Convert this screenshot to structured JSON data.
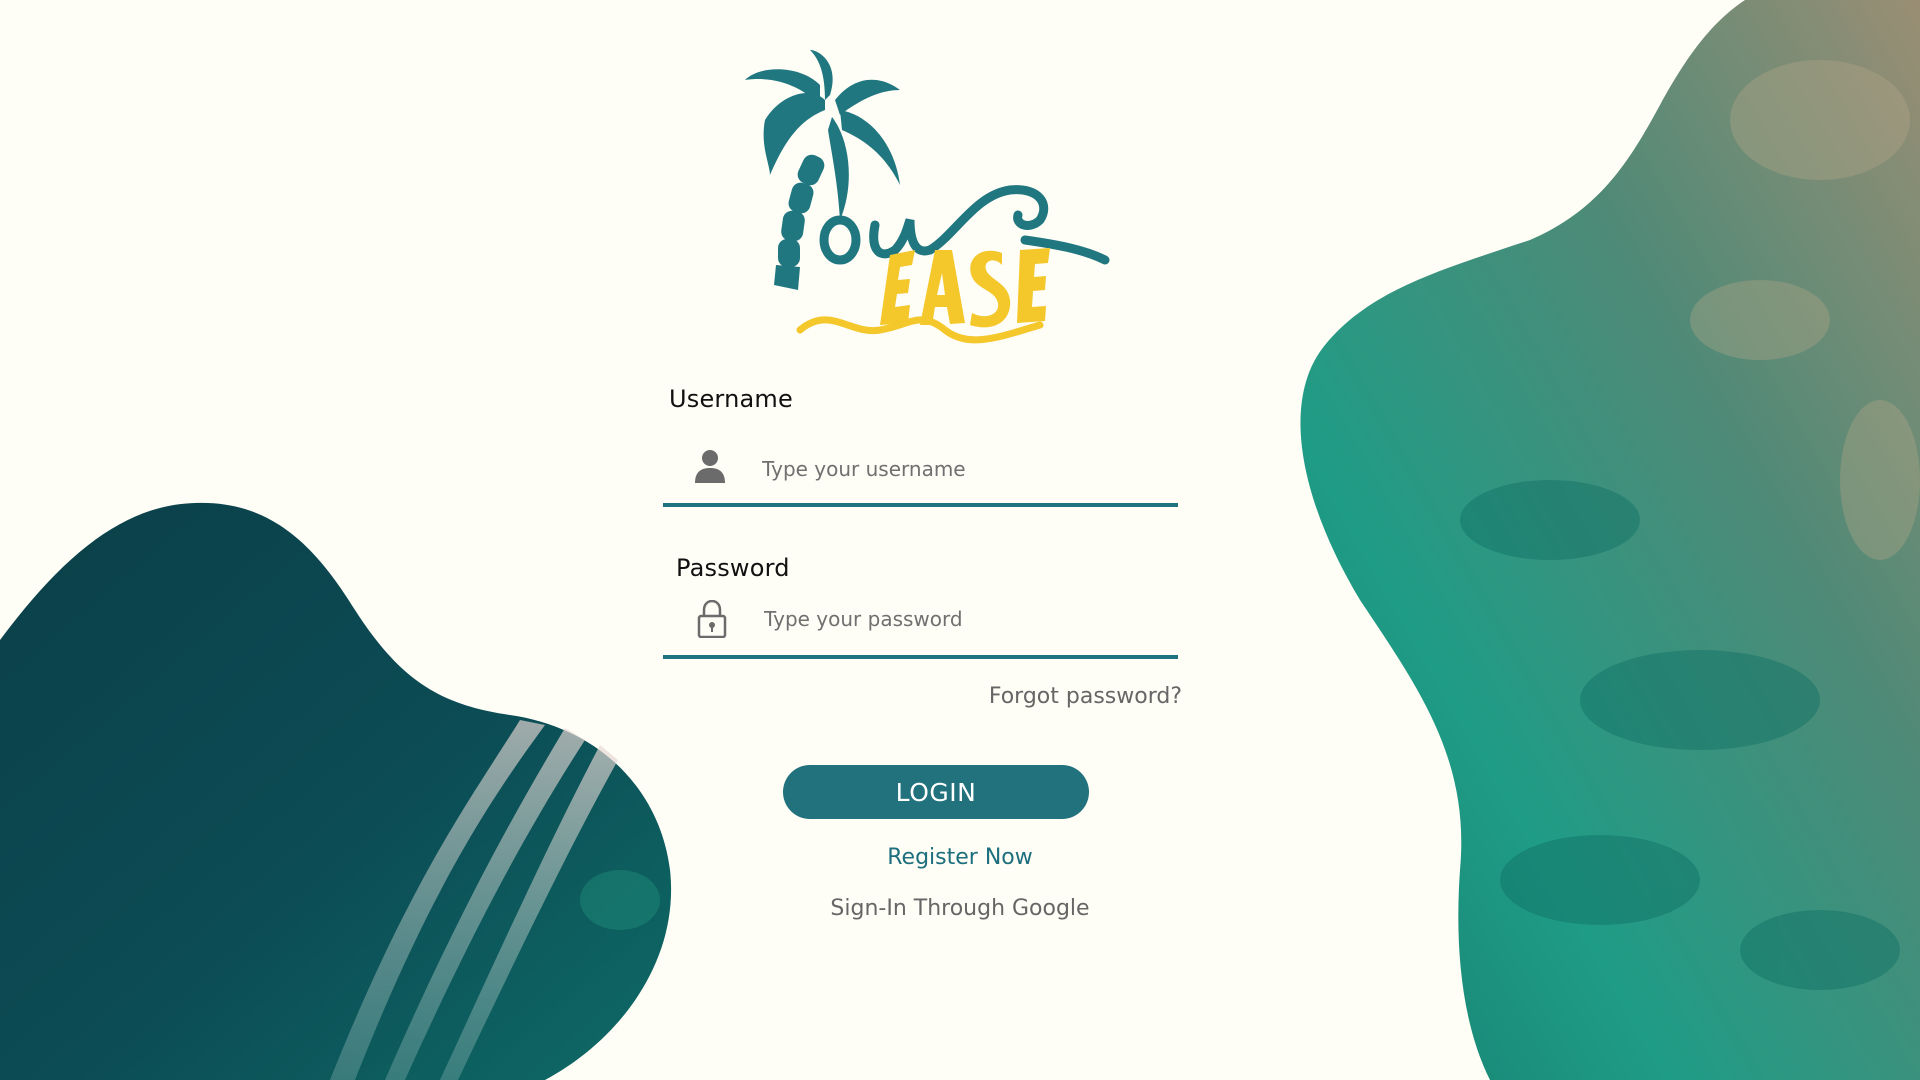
{
  "login": {
    "username_label": "Username",
    "username_placeholder": "Type your username",
    "password_label": "Password",
    "password_placeholder": "Type your password",
    "forgot_label": "Forgot password?",
    "login_label": "LOGIN",
    "register_label": "Register Now",
    "google_label": "Sign-In Through Google"
  },
  "colors": {
    "background": "#fefdf6",
    "accent_teal": "#21727d",
    "logo_yellow": "#f4c72b",
    "muted_text": "#666666"
  },
  "icons": {
    "username": "user-icon",
    "password": "lock-icon"
  }
}
